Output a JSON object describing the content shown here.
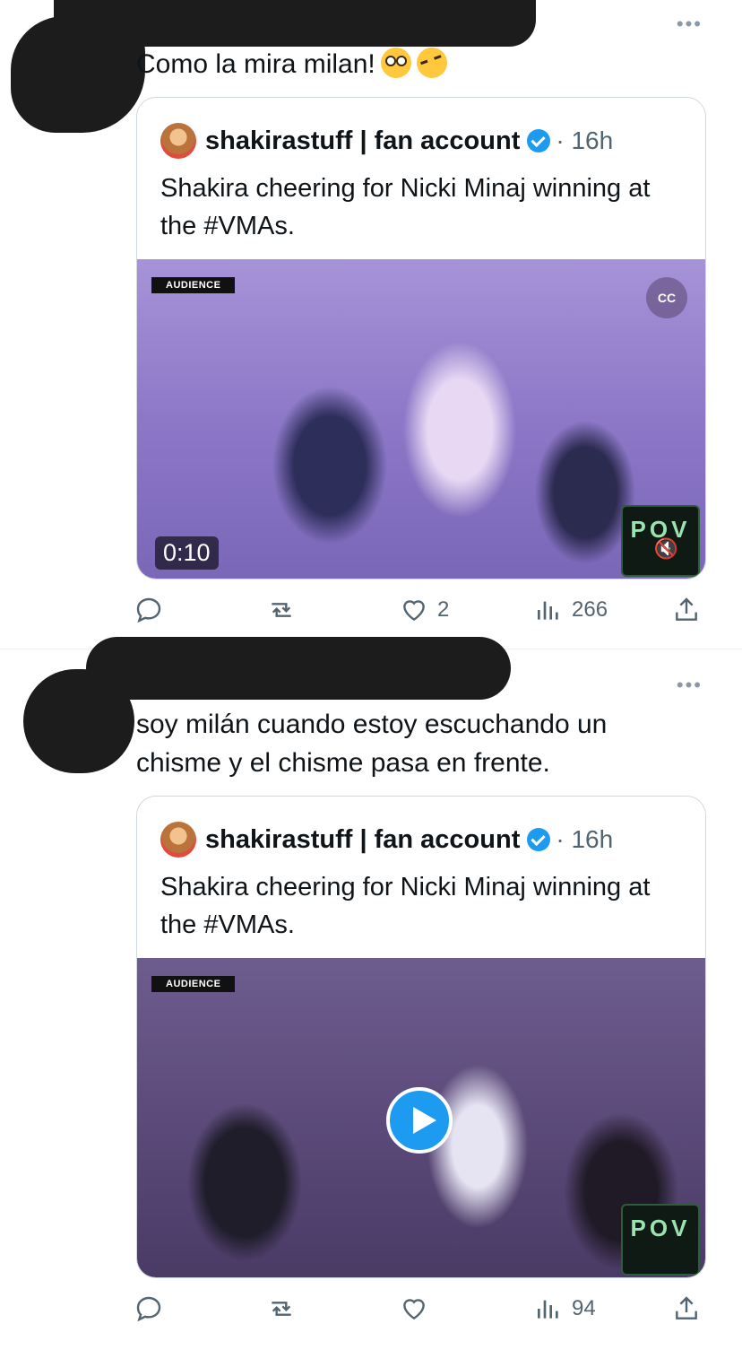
{
  "tweets": [
    {
      "more_label": "•••",
      "text": "Como la mira milan!",
      "emojis": [
        "flushed-face",
        "rolling-on-floor-laughing"
      ],
      "quote": {
        "author": "shakirastuff | fan account",
        "time": "· 16h",
        "text": "Shakira cheering for Nicki Minaj winning at the #VMAs.",
        "media": {
          "badge": "AUDIENCE",
          "cc_label": "CC",
          "duration": "0:10",
          "watermark": "POV"
        }
      },
      "actions": {
        "reply": "",
        "retweet": "",
        "like": "2",
        "views": "266"
      }
    },
    {
      "more_label": "•••",
      "text": "soy milán cuando estoy escuchando un chisme y el chisme pasa en frente.",
      "quote": {
        "author": "shakirastuff | fan account",
        "time": "· 16h",
        "text": "Shakira cheering for Nicki Minaj winning at the #VMAs.",
        "media": {
          "badge": "AUDIENCE",
          "watermark": "POV"
        }
      },
      "actions": {
        "reply": "",
        "retweet": "",
        "like": "",
        "views": "94"
      }
    }
  ],
  "colors": {
    "accent": "#1d9bf0",
    "muted_text": "#536471",
    "border": "#cfd9de"
  }
}
